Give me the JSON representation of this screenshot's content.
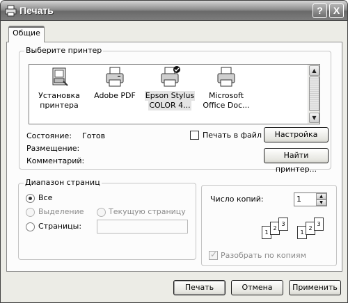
{
  "window": {
    "title": "Печать",
    "help_label": "?",
    "close_label": "X"
  },
  "tabs": [
    {
      "label": "Общие"
    }
  ],
  "printer_group": {
    "title": "Выберите принтер",
    "printers": [
      {
        "line1": "Установка",
        "line2": "принтера",
        "icon": "add-printer-icon"
      },
      {
        "line1": "Adobe PDF",
        "line2": "",
        "icon": "printer-icon"
      },
      {
        "line1": "Epson Stylus",
        "line2": "COLOR 4...",
        "icon": "printer-icon",
        "selected": true,
        "default": true
      },
      {
        "line1": "Microsoft",
        "line2": "Office Doc...",
        "icon": "printer-icon"
      }
    ],
    "status_label": "Состояние:",
    "status_value": "Готов",
    "location_label": "Размещение:",
    "comment_label": "Комментарий:",
    "print_to_file_label": "Печать в файл",
    "print_to_file_checked": false,
    "settings_button": "Настройка",
    "find_printer_button": "Найти принтер..."
  },
  "range_group": {
    "title": "Диапазон страниц",
    "all_label": "Все",
    "selection_label": "Выделение",
    "current_page_label": "Текущую страницу",
    "pages_label": "Страницы:",
    "pages_value": "",
    "selected": "all"
  },
  "copies": {
    "label": "Число копий:",
    "value": "1",
    "collate_label": "Разобрать по копиям",
    "collate_checked": true,
    "collate_enabled": false,
    "page_numbers": [
      "1",
      "2",
      "3"
    ]
  },
  "buttons": {
    "print": "Печать",
    "cancel": "Отмена",
    "apply": "Применить"
  }
}
